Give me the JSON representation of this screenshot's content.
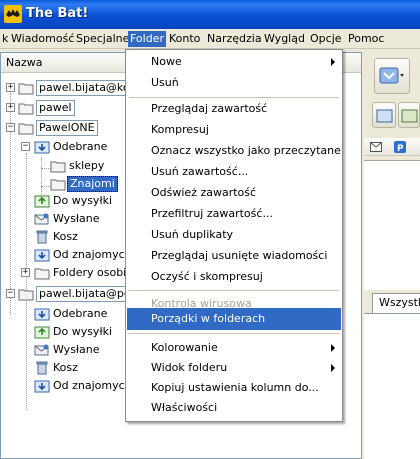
{
  "app": {
    "title": "The Bat!"
  },
  "menubar": {
    "items": [
      {
        "label": "Plik",
        "visible_text": "k"
      },
      {
        "label": "Wiadomość"
      },
      {
        "label": "Specjalne"
      },
      {
        "label": "Folder"
      },
      {
        "label": "Konto"
      },
      {
        "label": "Narzędzia"
      },
      {
        "label": "Wygląd"
      },
      {
        "label": "Opcje"
      },
      {
        "label": "Pomoc"
      }
    ],
    "active": "Folder"
  },
  "folder_tree": {
    "column_header": "Nazwa",
    "rows": [
      {
        "label": "pawel.bijata@kom",
        "type": "account",
        "expander": "+"
      },
      {
        "label": "pawel",
        "type": "account",
        "expander": "+"
      },
      {
        "label": "PawelONE",
        "type": "account",
        "expander": "-"
      },
      {
        "label": "Odebrane",
        "type": "inbox",
        "expander": "-"
      },
      {
        "label": "sklepy",
        "type": "folder"
      },
      {
        "label": "Znajomi",
        "type": "folder",
        "selected": true
      },
      {
        "label": "Do wysyłki",
        "type": "outbox"
      },
      {
        "label": "Wysłane",
        "type": "sent"
      },
      {
        "label": "Kosz",
        "type": "trash"
      },
      {
        "label": "Od znajomych",
        "type": "inbox"
      },
      {
        "label": "Foldery osobist",
        "type": "folder",
        "expander": "+"
      },
      {
        "label": "pawel.bijata@pcfc",
        "type": "account",
        "expander": "-"
      },
      {
        "label": "Odebrane",
        "type": "inbox"
      },
      {
        "label": "Do wysyłki",
        "type": "outbox"
      },
      {
        "label": "Wysłane",
        "type": "sent"
      },
      {
        "label": "Kosz",
        "type": "trash"
      },
      {
        "label": "Od znajomych",
        "type": "inbox"
      }
    ]
  },
  "folder_menu": {
    "items": [
      {
        "label": "Nowe",
        "submenu": true
      },
      {
        "label": "Usuń"
      },
      {
        "separator": true
      },
      {
        "label": "Przeglądaj zawartość"
      },
      {
        "label": "Kompresuj"
      },
      {
        "label": "Oznacz wszystko jako przeczytane"
      },
      {
        "label": "Usuń zawartość..."
      },
      {
        "label": "Odśwież zawartość"
      },
      {
        "label": "Przefiltruj zawartość..."
      },
      {
        "label": "Usuń duplikaty"
      },
      {
        "label": "Przeglądaj usunięte wiadomości"
      },
      {
        "label": "Oczyść i skompresuj"
      },
      {
        "separator": true
      },
      {
        "label": "Kontrola wirusowa",
        "disabled": true
      },
      {
        "label": "Porządki w folderach",
        "highlighted": true
      },
      {
        "separator": true
      },
      {
        "label": "Kolorowanie",
        "submenu": true
      },
      {
        "label": "Widok folderu",
        "submenu": true
      },
      {
        "label": "Kopiuj ustawienia kolumn do..."
      },
      {
        "label": "Właściwości"
      }
    ]
  },
  "right_pane": {
    "tab_label": "Wszystk"
  },
  "colors": {
    "titlebar": "#0a4fd0",
    "highlight": "#316ac5",
    "menubar": "#ece9d8"
  }
}
